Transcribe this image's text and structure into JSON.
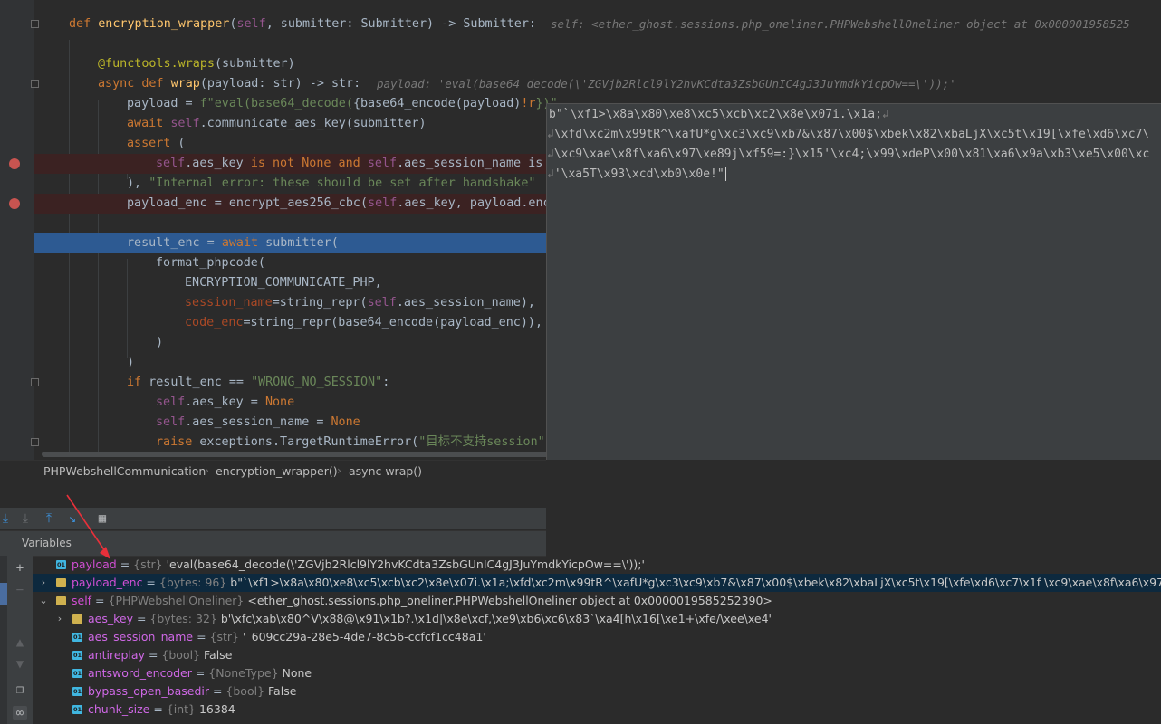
{
  "code": {
    "line1": {
      "def": "def ",
      "name": "encryption_wrapper",
      "p1": "(",
      "self": "self",
      "rest": ", submitter: Submitter) -> Submitter:",
      "hint": "self: <ether_ghost.sessions.php_oneliner.PHPWebshellOneliner object at 0x000001958525"
    },
    "line3": {
      "deco": "@functools.wraps",
      "rest": "(submitter)"
    },
    "line4": {
      "kw": "async def ",
      "name": "wrap",
      "rest": "(payload: str) -> str:",
      "hint": "payload: 'eval(base64_decode(\\'ZGVjb2Rlcl9lY2hvKCdta3ZsbGUnIC4gJ3JuYmdkYicpOw==\\'));'"
    },
    "line5": {
      "a": "payload = ",
      "fstr": "f\"eval(base64_decode(",
      "b": "{base64_encode(payload)",
      "c": "!r",
      "d": "})\""
    },
    "line6": {
      "kw": "await ",
      "a": "self",
      "b": ".communicate_aes_key(submitter)"
    },
    "line7": {
      "kw": "assert",
      "b": " ("
    },
    "line8": {
      "a": "self",
      "b": ".aes_key ",
      "k1": "is not None and ",
      "c": "self",
      "d": ".aes_session_name is"
    },
    "line9": {
      "a": "), ",
      "s": "\"Internal error: these should be set after handshake\""
    },
    "line10": {
      "a": "payload_enc = encrypt_aes256_cbc(",
      "b": "self",
      "c": ".aes_key, payload.enc"
    },
    "line12": {
      "a": "result_enc = ",
      "kw": "await",
      "b": " submitter("
    },
    "line13": {
      "a": "format_phpcode("
    },
    "line14": {
      "a": "ENCRYPTION_COMMUNICATE_PHP,"
    },
    "line15": {
      "k": "session_name",
      "a": "=string_repr(",
      "s": "self",
      "b": ".aes_session_name),"
    },
    "line16": {
      "k": "code_enc",
      "a": "=string_repr(base64_encode(payload_enc)),"
    },
    "line17": {
      "a": ")"
    },
    "line18": {
      "a": ")"
    },
    "line19": {
      "kw": "if",
      "a": " result_enc == ",
      "s": "\"WRONG_NO_SESSION\"",
      "b": ":"
    },
    "line20": {
      "a": "self",
      "b": ".aes_key = ",
      "c": "None"
    },
    "line21": {
      "a": "self",
      "b": ".aes_session_name = ",
      "c": "None"
    },
    "line22": {
      "kw": "raise",
      "a": " exceptions.TargetRuntimeError(",
      "s": "\"目标不支持session\"",
      "b": ")"
    }
  },
  "popup": {
    "line1": "b\"`\\xf1>\\x8a\\x80\\xe8\\xc5\\xcb\\xc2\\x8e\\x07i.\\x1a;",
    "line2": "\\xfd\\xc2m\\x99tR^\\xafU*g\\xc3\\xc9\\xb7&\\x87\\x00$\\xbek\\x82\\xbaLjX\\xc5t\\x19[\\xfe\\xd6\\xc7\\",
    "line3": "\\xc9\\xae\\x8f\\xa6\\x97\\xe89j\\xf59=:}\\x15'\\xc4;\\x99\\xdeP\\x00\\x81\\xa6\\x9a\\xb3\\xe5\\x00\\xc",
    "line4": "'\\xa5T\\x93\\xcd\\xb0\\x0e!\"",
    "wrap_glyph": "↲"
  },
  "breadcrumb": {
    "items": [
      "PHPWebshellCommunication",
      "encryption_wrapper()",
      "async wrap()"
    ],
    "separator": "›"
  },
  "debug": {
    "panel_title": "Variables",
    "variables": [
      {
        "name": "payload",
        "type": "{str}",
        "value": "'eval(base64_decode(\\'ZGVjb2Rlcl9lY2hvKCdta3ZsbGUnIC4gJ3JuYmdkYicpOw==\\'));'",
        "icon": "str",
        "expander": ""
      },
      {
        "name": "payload_enc",
        "type": "{bytes: 96}",
        "value": "b\"`\\xf1>\\x8a\\x80\\xe8\\xc5\\xcb\\xc2\\x8e\\x07i.\\x1a;\\xfd\\xc2m\\x99tR^\\xafU*g\\xc3\\xc9\\xb7&\\x87\\x00$\\xbek\\x82\\xbaLjX\\xc5t\\x19[\\xfe\\xd6\\xc7\\x1f \\xc9\\xae\\x8f\\xa6\\x97\\xe89j\\xf59=:}\\x15",
        "icon": "bytes",
        "expander": "›"
      },
      {
        "name": "self",
        "type": "{PHPWebshellOneliner}",
        "value": "<ether_ghost.sessions.php_oneliner.PHPWebshellOneliner object at 0x0000019585252390>",
        "icon": "obj",
        "expander": "⌄"
      },
      {
        "name": "aes_key",
        "type": "{bytes: 32}",
        "value": "b'\\xfc\\xab\\x80^V\\x88@\\x91\\x1b?.\\x1d|\\x8e\\xcf,\\xe9\\xb6\\xc6\\x83`\\xa4[h\\x16[\\xe1+\\xfe/\\xee\\xe4'",
        "icon": "bytes",
        "expander": "›"
      },
      {
        "name": "aes_session_name",
        "type": "{str}",
        "value": "'_609cc29a-28e5-4de7-8c56-ccfcf1cc48a1'",
        "icon": "str",
        "expander": ""
      },
      {
        "name": "antireplay",
        "type": "{bool}",
        "value": "False",
        "icon": "str",
        "expander": ""
      },
      {
        "name": "antsword_encoder",
        "type": "{NoneType}",
        "value": "None",
        "icon": "str",
        "expander": ""
      },
      {
        "name": "bypass_open_basedir",
        "type": "{bool}",
        "value": "False",
        "icon": "str",
        "expander": ""
      },
      {
        "name": "chunk_size",
        "type": "{int}",
        "value": "16384",
        "icon": "str",
        "expander": ""
      }
    ],
    "icon_label": "01",
    "equals": " = "
  },
  "colors": {
    "breakpoint": "#c75450",
    "current_line": "#2d5a92",
    "annotation_arrow": "#e8303a"
  }
}
